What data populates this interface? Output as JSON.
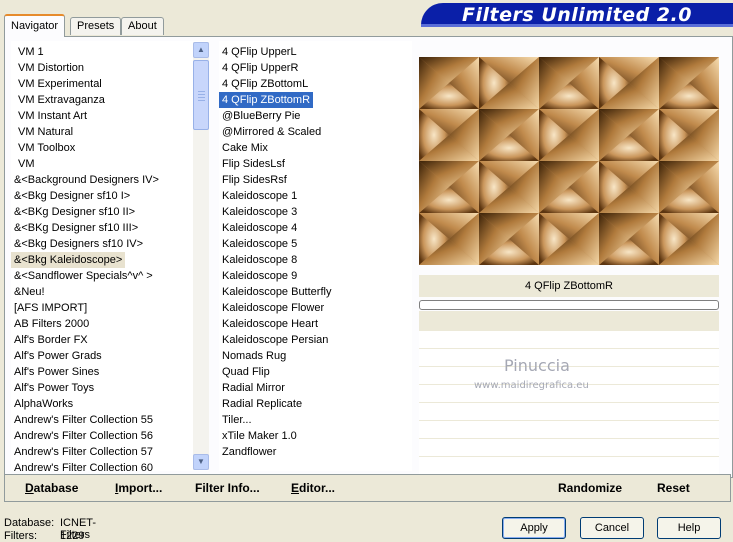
{
  "title": "Filters Unlimited 2.0",
  "tabs": [
    {
      "label": "Navigator",
      "active": true
    },
    {
      "label": "Presets",
      "active": false
    },
    {
      "label": "About",
      "active": false
    }
  ],
  "categories": [
    {
      "label": "VM 1",
      "indent": true
    },
    {
      "label": "VM Distortion",
      "indent": true
    },
    {
      "label": "VM Experimental",
      "indent": true
    },
    {
      "label": "VM Extravaganza",
      "indent": true
    },
    {
      "label": "VM Instant Art",
      "indent": true
    },
    {
      "label": "VM Natural",
      "indent": true
    },
    {
      "label": "VM Toolbox",
      "indent": true
    },
    {
      "label": "VM",
      "indent": true
    },
    {
      "label": "&<Background Designers IV>",
      "indent": false
    },
    {
      "label": "&<Bkg Designer sf10 I>",
      "indent": false
    },
    {
      "label": "&<BKg Designer sf10 II>",
      "indent": false
    },
    {
      "label": "&<BKg Designer sf10 III>",
      "indent": false
    },
    {
      "label": "&<Bkg Designers sf10 IV>",
      "indent": false
    },
    {
      "label": "&<Bkg Kaleidoscope>",
      "indent": false,
      "highlight": true
    },
    {
      "label": "&<Sandflower Specials^v^ >",
      "indent": false
    },
    {
      "label": "&Neu!",
      "indent": false
    },
    {
      "label": "[AFS IMPORT]",
      "indent": false
    },
    {
      "label": "AB Filters 2000",
      "indent": false
    },
    {
      "label": "Alf's Border FX",
      "indent": false
    },
    {
      "label": "Alf's Power Grads",
      "indent": false
    },
    {
      "label": "Alf's Power Sines",
      "indent": false
    },
    {
      "label": "Alf's Power Toys",
      "indent": false
    },
    {
      "label": "AlphaWorks",
      "indent": false
    },
    {
      "label": "Andrew's Filter Collection 55",
      "indent": false
    },
    {
      "label": "Andrew's Filter Collection 56",
      "indent": false
    },
    {
      "label": "Andrew's Filter Collection 57",
      "indent": false
    },
    {
      "label": "Andrew's Filter Collection 60",
      "indent": false
    }
  ],
  "filters": [
    {
      "label": "4 QFlip UpperL"
    },
    {
      "label": "4 QFlip UpperR"
    },
    {
      "label": "4 QFlip ZBottomL"
    },
    {
      "label": "4 QFlip ZBottomR",
      "selected": true
    },
    {
      "label": "@BlueBerry Pie"
    },
    {
      "label": "@Mirrored & Scaled"
    },
    {
      "label": "Cake Mix"
    },
    {
      "label": "Flip SidesLsf"
    },
    {
      "label": "Flip SidesRsf"
    },
    {
      "label": "Kaleidoscope 1"
    },
    {
      "label": "Kaleidoscope 3"
    },
    {
      "label": "Kaleidoscope 4"
    },
    {
      "label": "Kaleidoscope 5"
    },
    {
      "label": "Kaleidoscope 8"
    },
    {
      "label": "Kaleidoscope 9"
    },
    {
      "label": "Kaleidoscope Butterfly"
    },
    {
      "label": "Kaleidoscope Flower"
    },
    {
      "label": "Kaleidoscope Heart"
    },
    {
      "label": "Kaleidoscope Persian"
    },
    {
      "label": "Nomads Rug"
    },
    {
      "label": "Quad Flip"
    },
    {
      "label": "Radial Mirror"
    },
    {
      "label": "Radial Replicate"
    },
    {
      "label": "Tiler..."
    },
    {
      "label": "xTile Maker 1.0"
    },
    {
      "label": "Zandflower"
    }
  ],
  "preview": {
    "filter_name": "4 QFlip ZBottomR",
    "watermark_name": "Pinuccia",
    "watermark_url": "www.maidiregrafica.eu"
  },
  "toolbar": {
    "database": "Database",
    "import": "Import...",
    "filter_info": "Filter Info...",
    "editor": "Editor...",
    "randomize": "Randomize",
    "reset": "Reset"
  },
  "status": {
    "database_label": "Database:",
    "database_value": "ICNET-Filters",
    "filters_label": "Filters:",
    "filters_value": "1229"
  },
  "buttons": {
    "apply": "Apply",
    "cancel": "Cancel",
    "help": "Help"
  }
}
